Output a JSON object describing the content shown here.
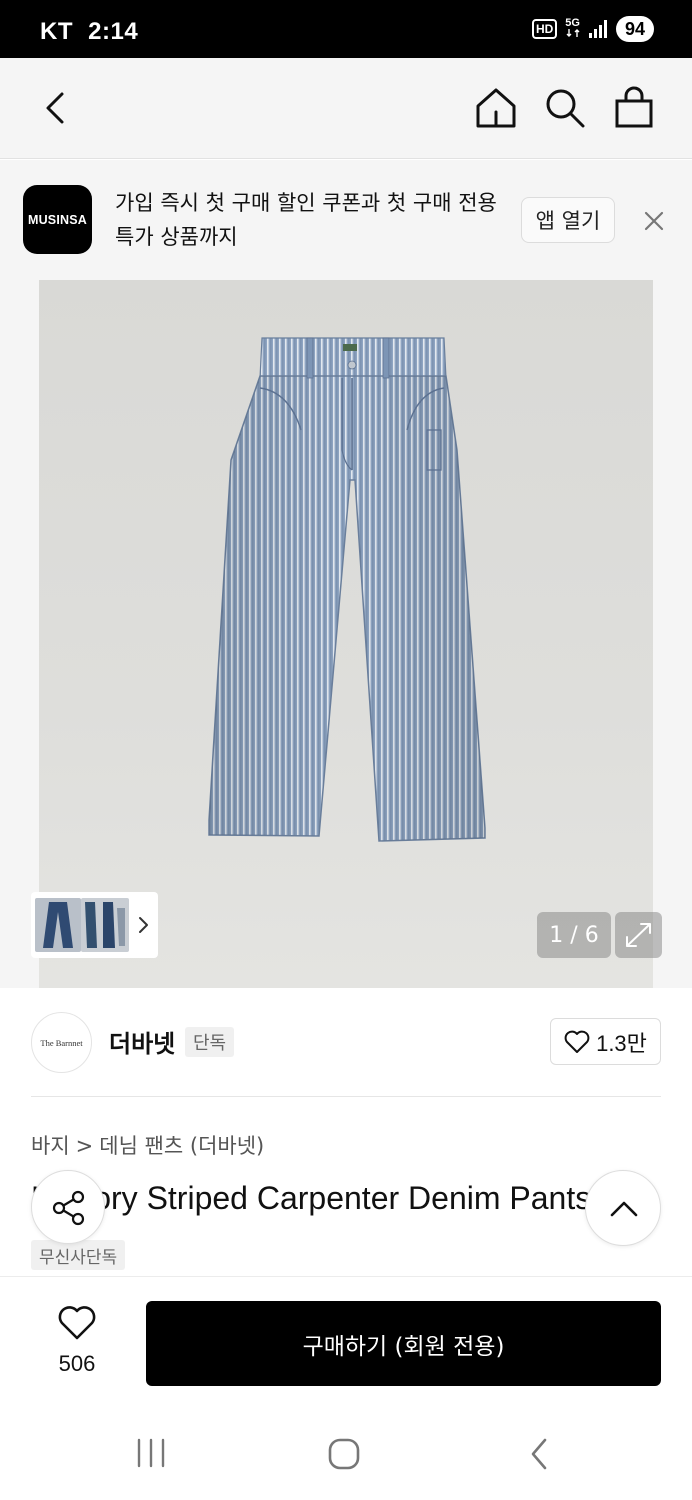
{
  "status_bar": {
    "carrier": "KT",
    "time": "2:14",
    "hd_label": "HD",
    "network_label": "5G",
    "battery": "94"
  },
  "nav": {
    "back_icon": "chevron-left-icon",
    "home_icon": "home-icon",
    "search_icon": "search-icon",
    "bag_icon": "shopping-bag-icon"
  },
  "app_banner": {
    "logo_text": "MUSINSA",
    "message": "가입 즉시 첫 구매 할인 쿠폰과 첫 구매 전용 특가 상품까지",
    "open_button": "앱 열기",
    "close_icon": "close-icon"
  },
  "gallery": {
    "page_indicator": "1 / 6",
    "expand_icon": "expand-icon",
    "thumbnail_arrow_icon": "chevron-right-icon"
  },
  "brand": {
    "logo_text": "The Barnnet",
    "name": "더바넷",
    "badge": "단독",
    "likes": "1.3만"
  },
  "product": {
    "breadcrumb": [
      "바지",
      "데님 팬츠 (더바넷)"
    ],
    "title": "Hickory Striped Carpenter Denim Pants",
    "badge": "무신사단독"
  },
  "floating": {
    "share_icon": "share-icon",
    "scroll_top_icon": "chevron-up-icon"
  },
  "purchase_bar": {
    "wish_icon": "heart-icon",
    "wish_count": "506",
    "buy_button": "구매하기 (회원 전용)"
  },
  "system_nav": {
    "recent_icon": "recent-apps-icon",
    "home_icon": "system-home-icon",
    "back_icon": "system-back-icon"
  },
  "colors": {
    "primary_button": "#000000",
    "denim": "#8ea4c1",
    "background": "#f5f5f5"
  }
}
